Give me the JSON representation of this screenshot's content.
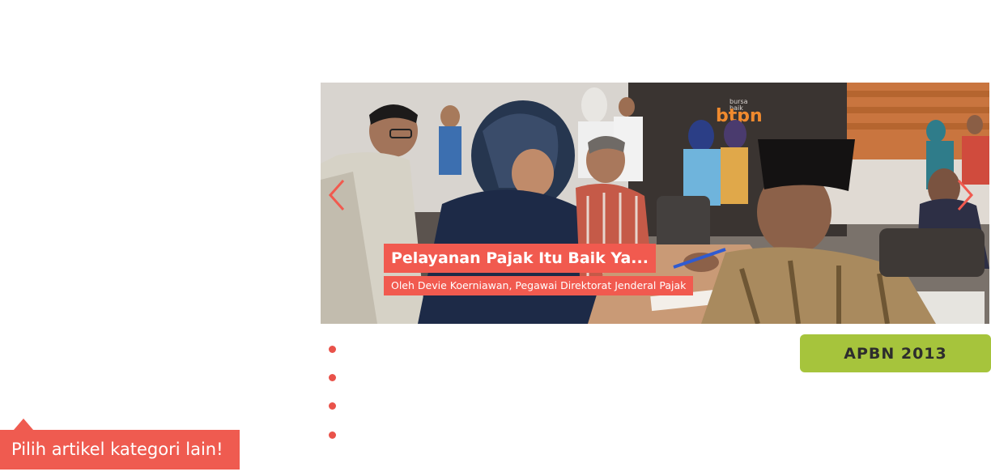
{
  "slider": {
    "slide": {
      "title": "Pelayanan Pajak Itu Baik Ya...",
      "subtitle": "Oleh Devie Koerniawan, Pegawai Direktorat Jenderal Pajak",
      "background_sign": "btpn"
    },
    "prev_icon": "chevron-left-icon",
    "next_icon": "chevron-right-icon",
    "bullet_count": 4,
    "colors": {
      "caption_bg": "#f15a4f",
      "arrow": "#f15a4f"
    }
  },
  "tag_button": {
    "label": "APBN 2013",
    "color": "#a6c43c"
  },
  "category_prompt": {
    "label": "Pilih artikel kategori lain!",
    "color": "#ef5b50"
  }
}
